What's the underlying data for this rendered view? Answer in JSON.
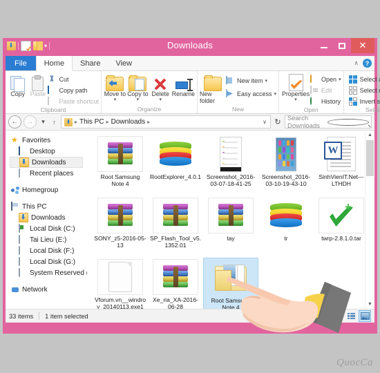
{
  "window": {
    "title": "Downloads",
    "quick_access": [
      "downloads-icon",
      "properties-icon",
      "new-folder-icon",
      "dropdown-arrow"
    ],
    "controls": {
      "minimize": "–",
      "maximize": "☐",
      "close": "✕"
    },
    "frame_color": "#e2649f",
    "close_color": "#e05c5c"
  },
  "ribbon": {
    "tabs": [
      {
        "label": "File",
        "active": false,
        "accent": "#2b7cd3"
      },
      {
        "label": "Home",
        "active": true
      },
      {
        "label": "Share",
        "active": false
      },
      {
        "label": "View",
        "active": false
      }
    ],
    "collapse_caret": "∧",
    "help_label": "?",
    "groups": [
      {
        "name": "Clipboard",
        "big": [
          {
            "label": "Copy",
            "icon": "copy-icon",
            "disabled": false
          },
          {
            "label": "Paste",
            "icon": "paste-icon",
            "disabled": true
          }
        ],
        "small": [
          {
            "label": "Cut",
            "icon": "scissors-icon",
            "disabled": false
          },
          {
            "label": "Copy path",
            "icon": "copy-path-icon",
            "disabled": false
          },
          {
            "label": "Paste shortcut",
            "icon": "paste-shortcut-icon",
            "disabled": true
          }
        ]
      },
      {
        "name": "Organize",
        "big": [
          {
            "label": "Move to",
            "icon": "move-to-icon",
            "dropdown": true
          },
          {
            "label": "Copy to",
            "icon": "copy-to-icon",
            "dropdown": true
          },
          {
            "label": "Delete",
            "icon": "delete-icon",
            "dropdown": true
          },
          {
            "label": "Rename",
            "icon": "rename-icon",
            "dropdown": false
          }
        ],
        "small": []
      },
      {
        "name": "New",
        "big": [
          {
            "label": "New folder",
            "icon": "new-folder-icon",
            "dropdown": false
          }
        ],
        "small": [
          {
            "label": "New item",
            "icon": "new-item-icon",
            "dropdown": true
          },
          {
            "label": "Easy access",
            "icon": "easy-access-icon",
            "dropdown": true
          }
        ]
      },
      {
        "name": "Open",
        "big": [
          {
            "label": "Properties",
            "icon": "properties-icon",
            "dropdown": true
          }
        ],
        "small": [
          {
            "label": "Open",
            "icon": "open-icon",
            "dropdown": true,
            "disabled": false
          },
          {
            "label": "Edit",
            "icon": "edit-icon",
            "disabled": true
          },
          {
            "label": "History",
            "icon": "history-icon",
            "disabled": false
          }
        ]
      },
      {
        "name": "Select",
        "big": [],
        "small": [
          {
            "label": "Select all",
            "icon": "select-all-icon"
          },
          {
            "label": "Select none",
            "icon": "select-none-icon"
          },
          {
            "label": "Invert selection",
            "icon": "invert-selection-icon"
          }
        ]
      }
    ]
  },
  "addressbar": {
    "back": "←",
    "forward": "→",
    "recent_caret": "▾",
    "up": "↑",
    "breadcrumb": [
      "This PC",
      "Downloads"
    ],
    "separator": "▸",
    "dropdown_caret": "∨",
    "refresh": "↻",
    "search_placeholder": "Search Downloads"
  },
  "sidebar": {
    "sections": [
      {
        "header": {
          "label": "Favorites",
          "icon": "star-icon"
        },
        "items": [
          {
            "label": "Desktop",
            "icon": "desktop-icon",
            "selected": false
          },
          {
            "label": "Downloads",
            "icon": "downloads-folder-icon",
            "selected": true
          },
          {
            "label": "Recent places",
            "icon": "recent-places-icon",
            "selected": false
          }
        ]
      },
      {
        "header": {
          "label": "Homegroup",
          "icon": "homegroup-icon"
        },
        "items": []
      },
      {
        "header": {
          "label": "This PC",
          "icon": "this-pc-icon"
        },
        "items": [
          {
            "label": "Downloads",
            "icon": "downloads-folder-icon",
            "selected": false
          },
          {
            "label": "Local Disk (C:)",
            "icon": "system-drive-icon",
            "selected": false
          },
          {
            "label": "Tai Lieu (E:)",
            "icon": "drive-icon",
            "selected": false
          },
          {
            "label": "Local Disk (F:)",
            "icon": "drive-icon",
            "selected": false
          },
          {
            "label": "Local Disk (G:)",
            "icon": "drive-icon",
            "selected": false
          },
          {
            "label": "System Reserved (H:",
            "icon": "drive-icon",
            "selected": false
          }
        ]
      },
      {
        "header": {
          "label": "Network",
          "icon": "network-icon"
        },
        "items": []
      }
    ]
  },
  "files": [
    {
      "name": "Root Samsung Note 4",
      "icon": "rar-archive-icon",
      "selected": false
    },
    {
      "name": "RootExplorer_4.0.1",
      "icon": "bluestacks-icon",
      "selected": false
    },
    {
      "name": "Screenshot_2016-03-07-18-41-25",
      "icon": "android-screenshot-list-icon",
      "selected": false
    },
    {
      "name": "Screenshot_2016-03-10-19-43-10",
      "icon": "android-screenshot-grid-icon",
      "selected": false
    },
    {
      "name": "SinhVienIT.Net---LTHDH",
      "icon": "word-document-icon",
      "selected": false
    },
    {
      "name": "SONY_z5-2016-05-13",
      "icon": "rar-archive-icon",
      "selected": false
    },
    {
      "name": "SP_Flash_Tool_v5.1352.01",
      "icon": "rar-archive-icon",
      "selected": false
    },
    {
      "name": "tay",
      "icon": "rar-archive-icon",
      "selected": false
    },
    {
      "name": "tr",
      "icon": "bluestacks-icon",
      "selected": false
    },
    {
      "name": "twrp-2.8.1.0.tar",
      "icon": "green-check-archive-icon",
      "selected": false
    },
    {
      "name": "Vforum.vn__windroy_20140113.exe1",
      "icon": "blank-file-icon",
      "selected": false
    },
    {
      "name": "Xe_ria_XA-2016-06-28",
      "icon": "rar-archive-icon",
      "selected": false
    },
    {
      "name": "Root Samsung Note 4",
      "icon": "open-folder-pictures-icon",
      "selected": true
    }
  ],
  "statusbar": {
    "item_count": "33 items",
    "selection": "1 item selected",
    "views": [
      {
        "name": "details-view",
        "active": false
      },
      {
        "name": "thumbnails-view",
        "active": true
      }
    ]
  },
  "overlay": {
    "cursor": "pointing-hand-illustration",
    "watermark": "QuocCa"
  },
  "colors": {
    "frame_pink": "#e2649f",
    "file_tab_blue": "#2b7cd3",
    "selection_blue": "#cde6f7",
    "desktop_gray": "#c4c4c4"
  }
}
